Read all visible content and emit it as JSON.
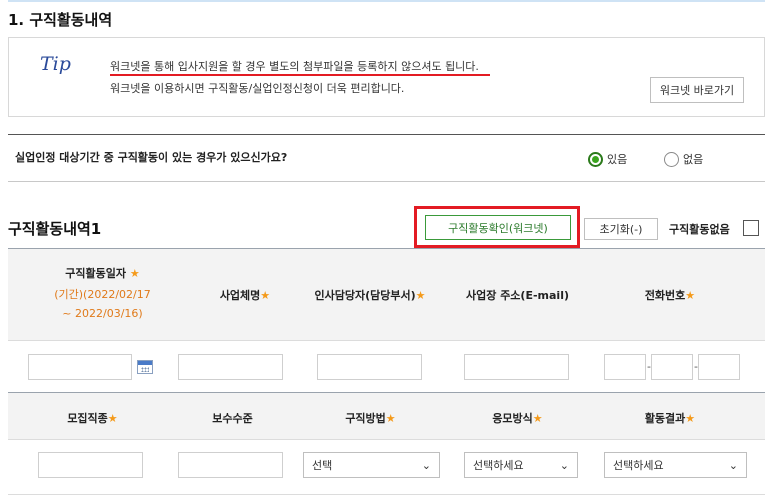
{
  "section": {
    "title": "1. 구직활동내역"
  },
  "tip": {
    "icon_label": "Tip",
    "line1": "워크넷을 통해 입사지원을 할 경우 별도의 첨부파일을 등록하지 않으셔도 됩니다.",
    "line2": "워크넷을 이용하시면 구직활동/실업인정신청이 더욱 편리합니다.",
    "worknet_button": "워크넷 바로가기"
  },
  "question": {
    "text": "실업인정 대상기간 중 구직활동이 있는 경우가 있으신가요?",
    "yes_label": "있음",
    "no_label": "없음",
    "selected": "있음"
  },
  "activity": {
    "title": "구직활동내역1",
    "confirm_button": "구직활동확인(워크넷)",
    "reset_button": "초기화(-)",
    "none_label": "구직활동없음",
    "accent_color": "#e31b23"
  },
  "table": {
    "header1": {
      "date_label": "구직활동일자",
      "date_period": "(기간)(2022/02/17",
      "date_end": "~ 2022/03/16)",
      "company": "사업체명",
      "manager": "인사담당자(담당부서)",
      "address": "사업장 주소(E-mail)",
      "phone": "전화번호"
    },
    "header2": {
      "position": "모집직종",
      "salary": "보수수준",
      "method": "구직방법",
      "apply": "응모방식",
      "result": "활동결과"
    },
    "selects": {
      "method": "선택",
      "apply": "선택하세요",
      "result": "선택하세요"
    },
    "star": "★"
  }
}
